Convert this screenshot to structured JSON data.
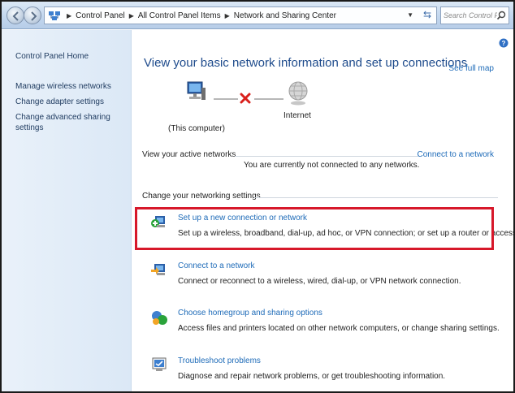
{
  "breadcrumb": {
    "items": [
      "Control Panel",
      "All Control Panel Items",
      "Network and Sharing Center"
    ]
  },
  "search": {
    "placeholder": "Search Control Panel"
  },
  "sidebar": {
    "home": "Control Panel Home",
    "items": [
      {
        "label": "Manage wireless networks"
      },
      {
        "label": "Change adapter settings"
      },
      {
        "label": "Change advanced sharing settings"
      }
    ]
  },
  "main": {
    "title": "View your basic network information and set up connections",
    "see_full_map": "See full map",
    "map": {
      "computer_label": "(This computer)",
      "internet_label": "Internet"
    },
    "active_networks": {
      "title": "View your active networks",
      "connect_link": "Connect to a network",
      "status": "You are currently not connected to any networks."
    },
    "settings": {
      "title": "Change your networking settings",
      "tasks": [
        {
          "link": "Set up a new connection or network",
          "desc": "Set up a wireless, broadband, dial-up, ad hoc, or VPN connection; or set up a router or access point.",
          "icon": "new-connection-icon"
        },
        {
          "link": "Connect to a network",
          "desc": "Connect or reconnect to a wireless, wired, dial-up, or VPN network connection.",
          "icon": "connect-network-icon"
        },
        {
          "link": "Choose homegroup and sharing options",
          "desc": "Access files and printers located on other network computers, or change sharing settings.",
          "icon": "homegroup-icon"
        },
        {
          "link": "Troubleshoot problems",
          "desc": "Diagnose and repair network problems, or get troubleshooting information.",
          "icon": "troubleshoot-icon"
        }
      ]
    }
  },
  "colors": {
    "link": "#1e6bb8",
    "title": "#1e4b8c",
    "highlight_border": "#d7182a",
    "error_x": "#d9201c"
  }
}
